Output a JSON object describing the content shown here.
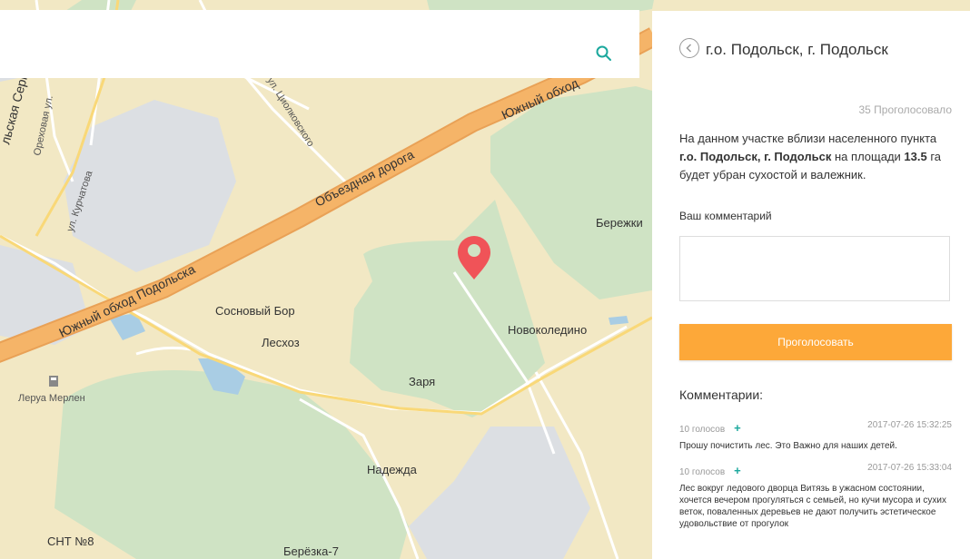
{
  "search": {
    "placeholder": ""
  },
  "map": {
    "labels": {
      "podolsk_bypass_south": "Южный обход Подольска",
      "bypass_road": "Объездная дорога",
      "southern_bypass_right": "Южный обход",
      "sosnovy_bor": "Сосновый Бор",
      "leskhoz": "Лесхоз",
      "novokoledino": "Новоколедино",
      "zarya": "Заря",
      "nadezhda": "Надежда",
      "snt8": "СНТ №8",
      "berezka7": "Берёзка-7",
      "berezhki": "Бережки",
      "leroy_merlin": "Леруа Мерлен",
      "kurchatova": "ул. Курчатова",
      "orekhovaya": "Ореховая ул.",
      "tsiolkovskogo": "ул. Циолковского",
      "serpukhovskaya_fragment": "льская Серп"
    },
    "colors": {
      "background": "#f2e8c4",
      "forest": "#cfe3c4",
      "highway": "#f5b468",
      "road": "#ffffff",
      "water": "#a9cde4",
      "industrial": "#dcdfe3",
      "pin": "#f05358"
    }
  },
  "panel": {
    "title": "г.о. Подольск, г. Подольск",
    "votes_count": "35 Проголосовало",
    "desc_prefix": "На данном участке вблизи населенного пункта ",
    "desc_location": "г.о. Подольск, г. Подольск",
    "desc_middle": " на площади ",
    "desc_area": "13.5",
    "desc_suffix": " га будет убран сухостой и валежник.",
    "comment_label": "Ваш комментарий",
    "vote_button": "Проголосовать",
    "comments_heading": "Комментарии:",
    "comments": [
      {
        "votes": "10 голосов",
        "plus": "+",
        "date": "2017-07-26 15:32:25",
        "text": "Прошу почистить лес. Это Важно для наших детей."
      },
      {
        "votes": "10 голосов",
        "plus": "+",
        "date": "2017-07-26 15:33:04",
        "text": "Лес вокруг ледового дворца Витязь в ужасном состоянии, хочется вечером прогуляться с семьей, но кучи мусора и сухих веток, поваленных деревьев не дают получить эстетическое удовольствие от прогулок"
      }
    ]
  }
}
